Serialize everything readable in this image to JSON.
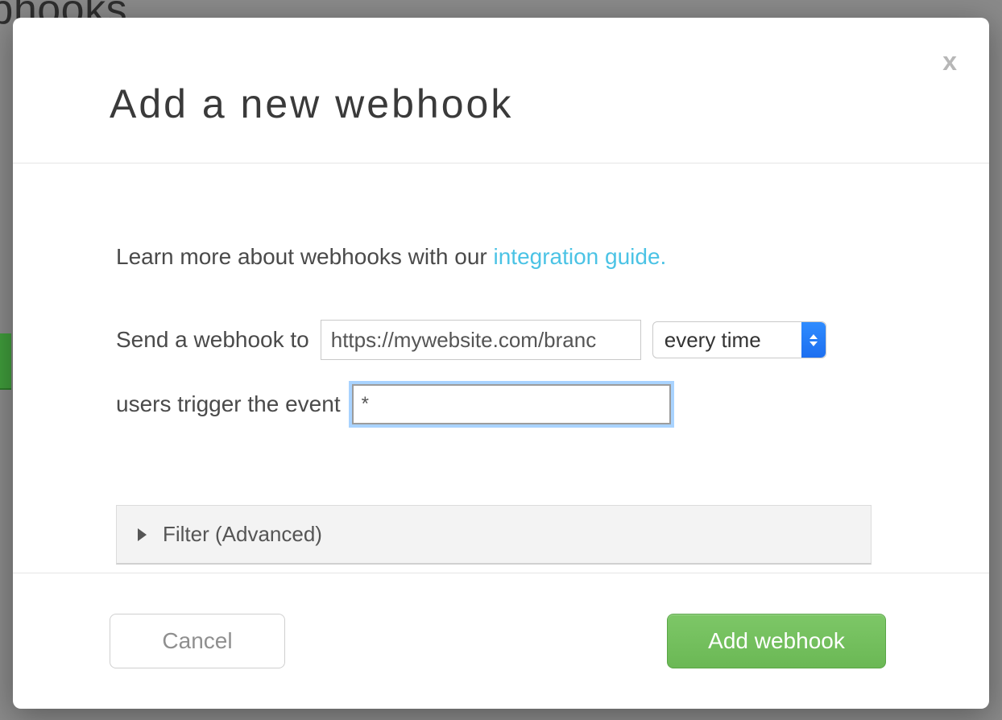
{
  "background": {
    "page_title_partial": "ebhooks"
  },
  "modal": {
    "title": "Add a new webhook",
    "close_label": "x",
    "intro_text_prefix": "Learn more about webhooks with our ",
    "intro_link_text": "integration guide.",
    "row1_prefix": "Send a webhook to",
    "url_value": "https://mywebsite.com/branc",
    "frequency_selected": "every time",
    "row2_prefix": "users trigger the event",
    "event_value": "*",
    "filter_label": "Filter (Advanced)",
    "cancel_label": "Cancel",
    "submit_label": "Add webhook"
  }
}
